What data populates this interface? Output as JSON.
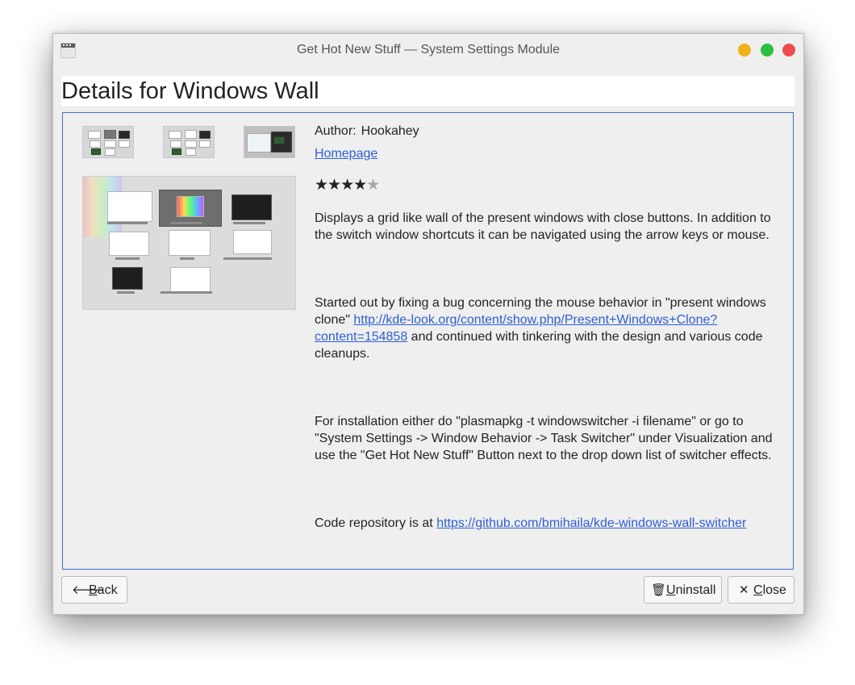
{
  "window": {
    "title": "Get Hot New Stuff — System Settings Module",
    "buttons": {
      "minimize_color": "#f2b01e",
      "maximize_color": "#2bbf3e",
      "close_color": "#ee4c4c"
    }
  },
  "header": {
    "title": "Details for Windows Wall"
  },
  "details": {
    "author_label": "Author:",
    "author_value": "Hookahey",
    "homepage_label": "Homepage",
    "rating": {
      "filled": 4,
      "max": 5,
      "filled_glyph": "★★★★",
      "empty_glyph": "★"
    },
    "description": {
      "p1": "Displays a grid like wall of the present windows with close buttons. In addition to the switch window shortcuts it can be navigated using the arrow keys or mouse.",
      "p2_before": "Started out by fixing a bug concerning the mouse behavior in \"present windows clone\" ",
      "p2_link": "http://kde-look.org/content/show.php/Present+Windows+Clone?content=154858",
      "p2_after": " and continued with tinkering with the design and various code cleanups.",
      "p3": "For installation either do \"plasmapkg -t windowswitcher -i filename\" or go to \"System Settings -> Window Behavior -> Task Switcher\" under Visualization and use the \"Get Hot New Stuff\" Button next to the drop down list of switcher effects.",
      "p4_before": "Code repository is at ",
      "p4_link": "https://github.com/bmihaila/kde-windows-wall-switcher"
    }
  },
  "screenshots": {
    "count": 3,
    "selected": 3
  },
  "footer": {
    "back_label": "Back",
    "uninstall_label": "Uninstall",
    "close_label": "Close",
    "back_icon": "arrow-left-icon",
    "uninstall_icon": "trash-icon",
    "close_icon": "x-icon"
  },
  "colors": {
    "accent": "#3d6ed5",
    "link": "#2d5fd4"
  }
}
